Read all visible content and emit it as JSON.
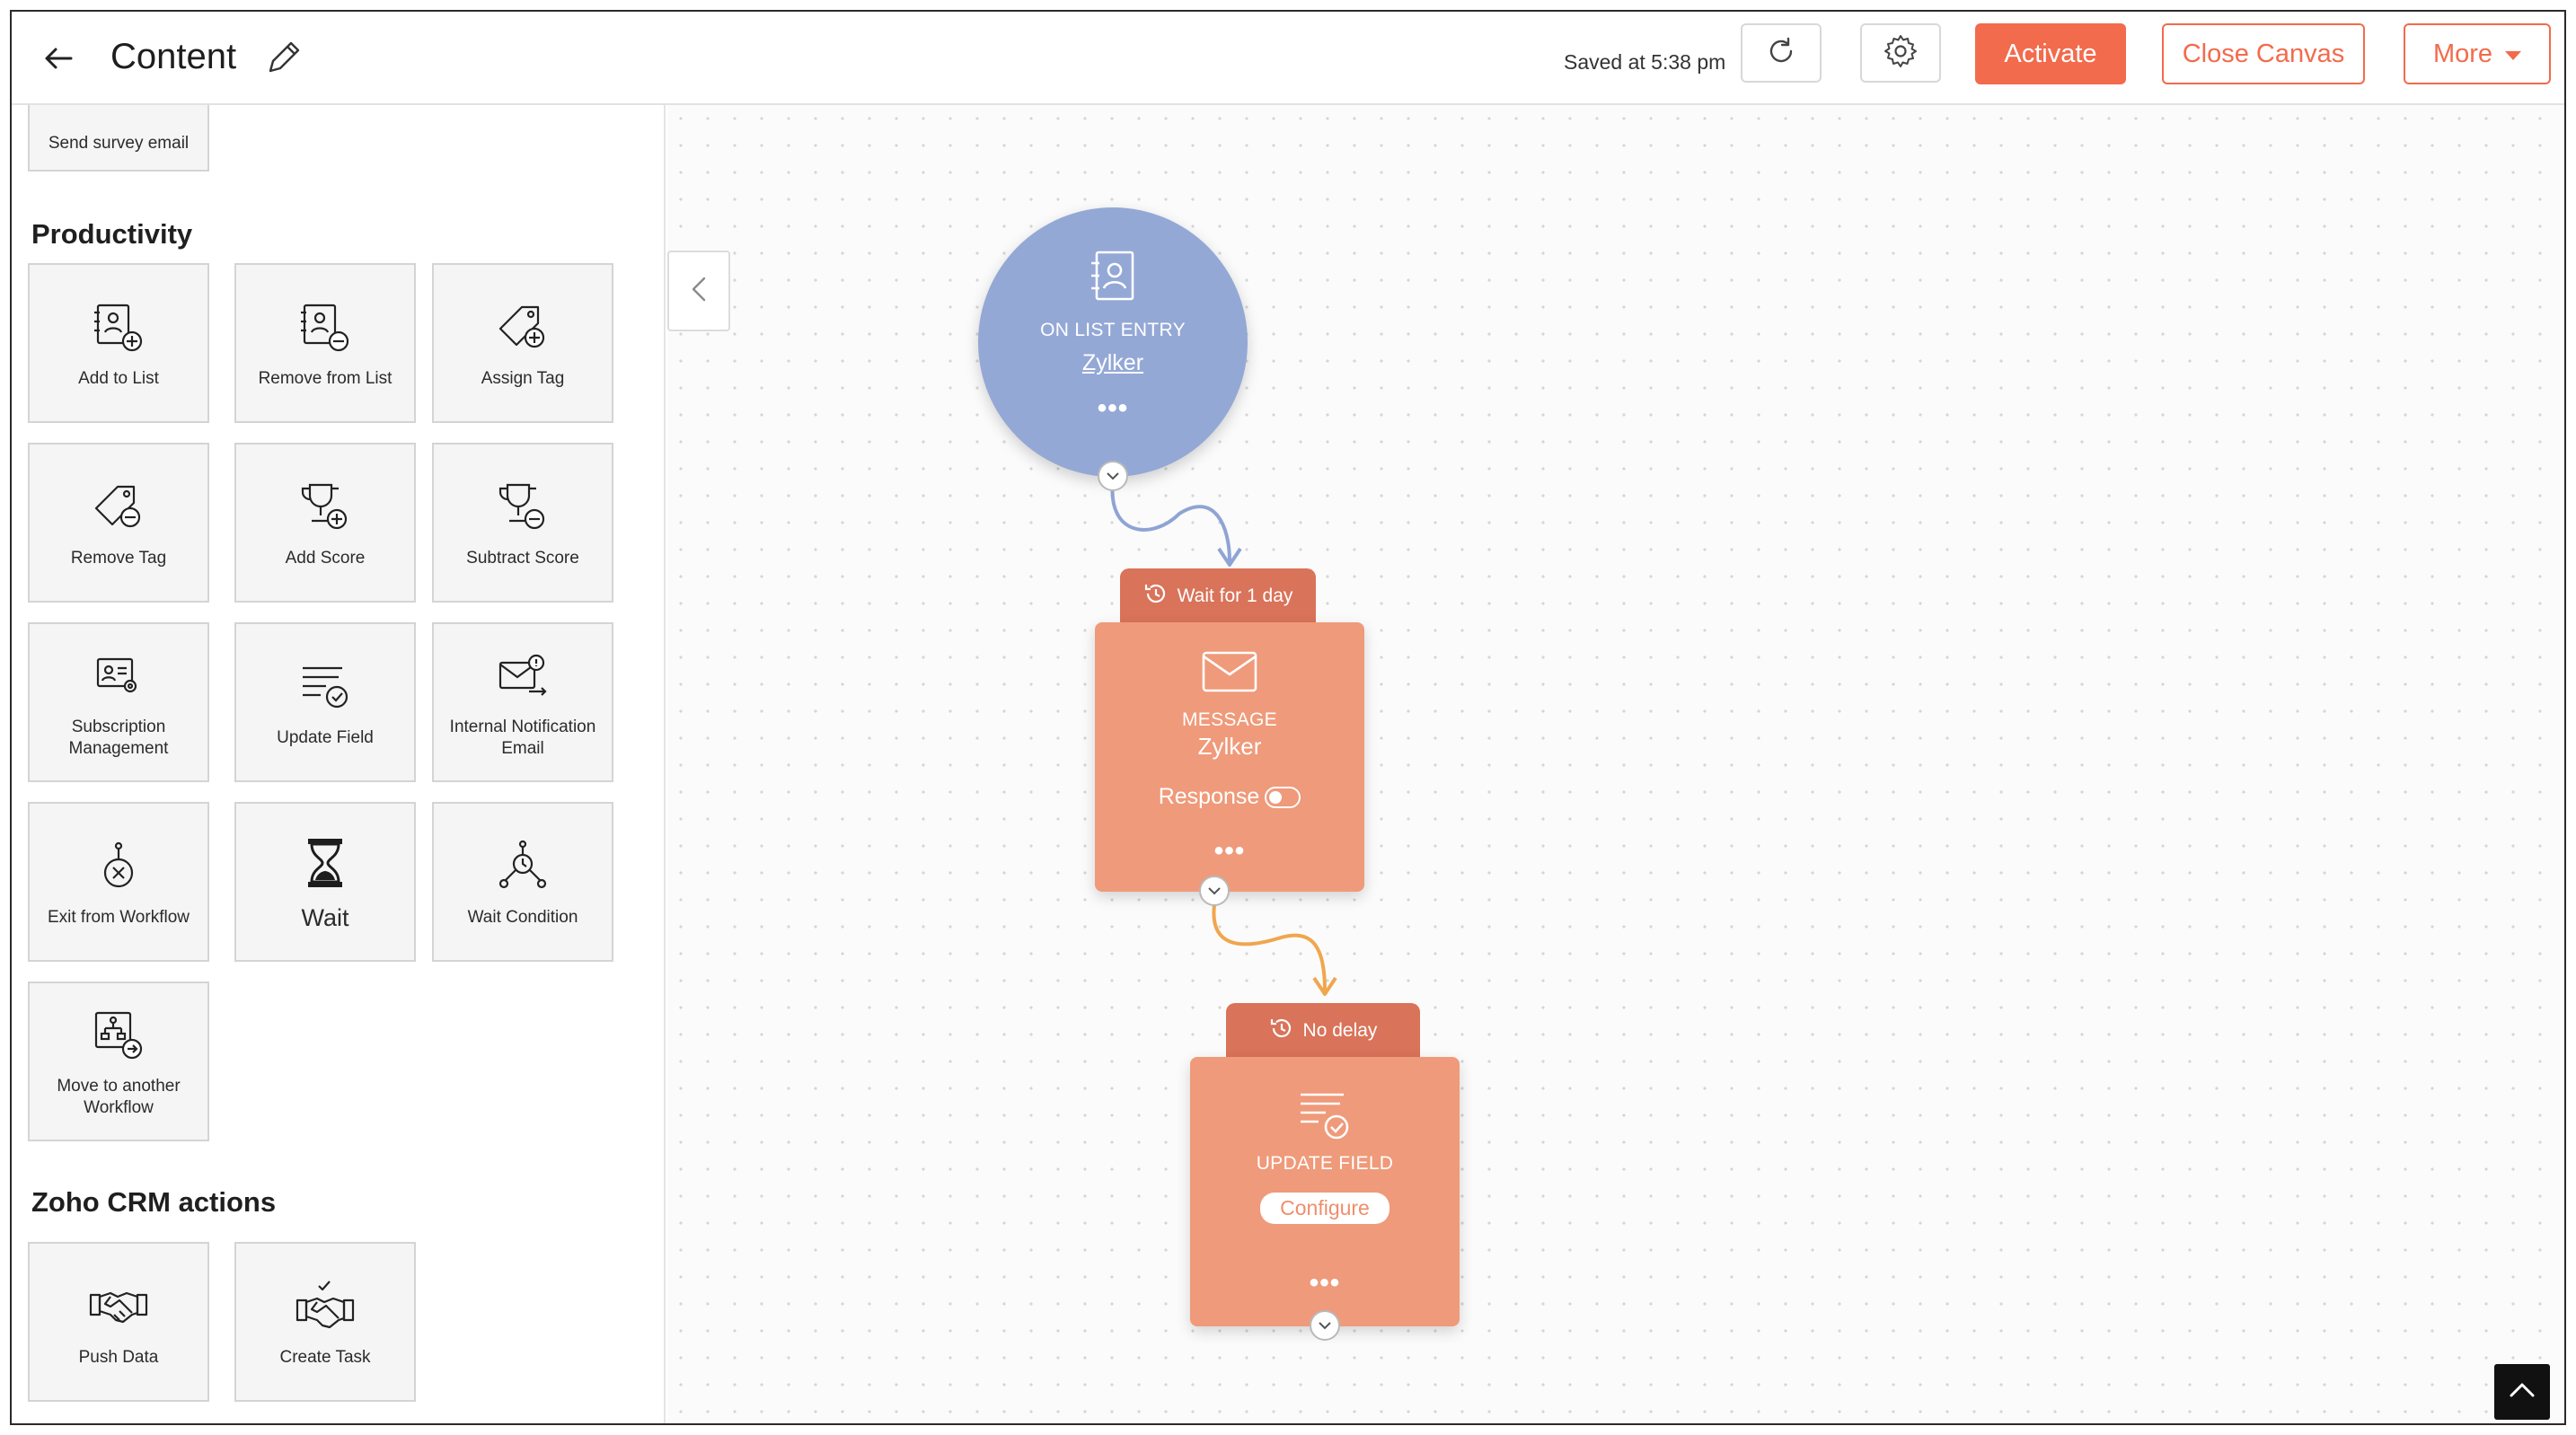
{
  "header": {
    "back_icon": "arrow-left-icon",
    "title": "Content",
    "edit_icon": "pencil-icon",
    "saved_status": "Saved at 5:38 pm",
    "refresh_icon": "refresh-icon",
    "settings_icon": "gear-icon",
    "activate_label": "Activate",
    "close_canvas_label": "Close Canvas",
    "more_label": "More"
  },
  "sidebar": {
    "partial_tile": {
      "label": "Send survey email"
    },
    "productivity": {
      "title": "Productivity",
      "tiles": [
        {
          "label": "Add to List",
          "icon": "list-add-icon"
        },
        {
          "label": "Remove from List",
          "icon": "list-remove-icon"
        },
        {
          "label": "Assign Tag",
          "icon": "tag-add-icon"
        },
        {
          "label": "Remove Tag",
          "icon": "tag-remove-icon"
        },
        {
          "label": "Add Score",
          "icon": "trophy-add-icon"
        },
        {
          "label": "Subtract Score",
          "icon": "trophy-subtract-icon"
        },
        {
          "label": "Subscription Management",
          "icon": "subscription-icon"
        },
        {
          "label": "Update Field",
          "icon": "update-field-icon"
        },
        {
          "label": "Internal Notification Email",
          "icon": "notification-email-icon"
        },
        {
          "label": "Exit from Workflow",
          "icon": "exit-workflow-icon"
        },
        {
          "label": "Wait",
          "icon": "hourglass-icon"
        },
        {
          "label": "Wait Condition",
          "icon": "wait-condition-icon"
        },
        {
          "label": "Move to another Workflow",
          "icon": "move-workflow-icon"
        }
      ]
    },
    "crm": {
      "title": "Zoho CRM actions",
      "tiles": [
        {
          "label": "Push Data",
          "icon": "handshake-icon"
        },
        {
          "label": "Create Task",
          "icon": "handshake-task-icon"
        }
      ]
    }
  },
  "canvas": {
    "entry_node": {
      "type_label": "ON LIST ENTRY",
      "list_name": "Zylker",
      "icon": "contact-list-icon"
    },
    "message_node": {
      "delay_label": "Wait for 1 day",
      "type_label": "MESSAGE",
      "name": "Zylker",
      "response_label": "Response",
      "icon": "envelope-icon"
    },
    "update_node": {
      "delay_label": "No delay",
      "type_label": "UPDATE FIELD",
      "configure_label": "Configure",
      "icon": "update-field-icon"
    },
    "connector_colors": {
      "entry": "#8fa4d4",
      "message": "#f0a64e"
    },
    "accent": "#f26b4c"
  }
}
